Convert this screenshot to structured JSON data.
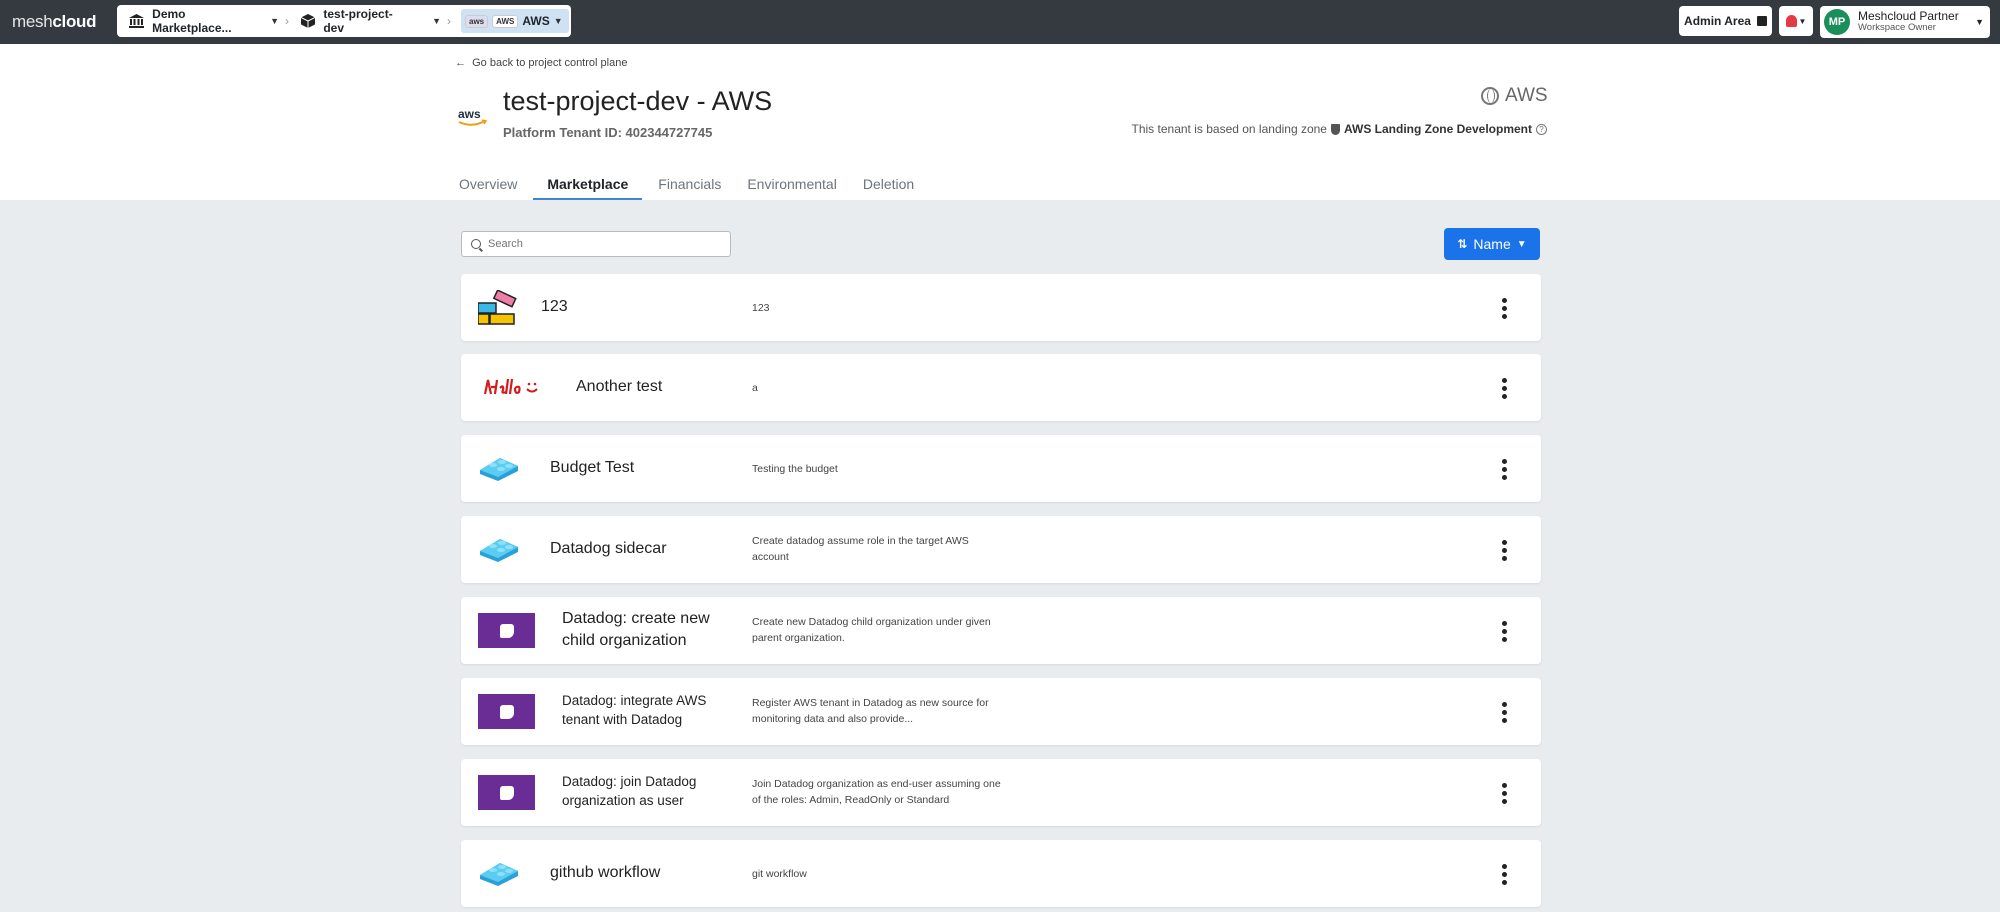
{
  "brand": {
    "left": "mesh",
    "right": "cloud"
  },
  "breadcrumbs": {
    "workspace": "Demo Marketplace...",
    "project": "test-project-dev",
    "platform_pill_1": "aws",
    "platform_pill_2": "AWS",
    "platform": "AWS"
  },
  "topbar": {
    "admin_label": "Admin Area",
    "user_initials": "MP",
    "user_name": "Meshcloud Partner",
    "user_role": "Workspace Owner"
  },
  "header": {
    "back_link": "Go back to project control plane",
    "title": "test-project-dev - AWS",
    "tenant_id": "Platform Tenant ID: 402344727745",
    "platform": "AWS",
    "landing_prefix": "This tenant is based on landing zone",
    "landing_zone": "AWS Landing Zone Development",
    "aws_logo_text": "aws"
  },
  "tabs": [
    {
      "label": "Overview",
      "active": false
    },
    {
      "label": "Marketplace",
      "active": true
    },
    {
      "label": "Financials",
      "active": false
    },
    {
      "label": "Environmental",
      "active": false
    },
    {
      "label": "Deletion",
      "active": false
    }
  ],
  "toolbar": {
    "search_placeholder": "Search",
    "sort_label": "Name"
  },
  "items": [
    {
      "name": "123",
      "description": "123",
      "icon": "lego-blocks-icon"
    },
    {
      "name": "Another test",
      "description": "a",
      "icon": "hello-logo-icon"
    },
    {
      "name": "Budget Test",
      "description": "Testing the budget",
      "icon": "blue-brick-icon"
    },
    {
      "name": "Datadog sidecar",
      "description": "Create datadog assume role in the target AWS account",
      "icon": "blue-brick-icon"
    },
    {
      "name": "Datadog: create new child organization",
      "description": "Create new Datadog child organization under given parent organization.",
      "icon": "datadog-icon"
    },
    {
      "name": "Datadog: integrate AWS tenant with Datadog",
      "description": "Register AWS tenant in Datadog as new source for monitoring data and also provide...",
      "icon": "datadog-icon"
    },
    {
      "name": "Datadog: join Datadog organization as user",
      "description": "Join Datadog organization as end-user assuming one of the roles: Admin, ReadOnly or Standard",
      "icon": "datadog-icon"
    },
    {
      "name": "github workflow",
      "description": "git workflow",
      "icon": "blue-brick-icon"
    }
  ],
  "colors": {
    "topbar": "#343a40",
    "accent": "#1a73e8",
    "datadog": "#6a2d96",
    "brick": "#3bb9e6"
  }
}
